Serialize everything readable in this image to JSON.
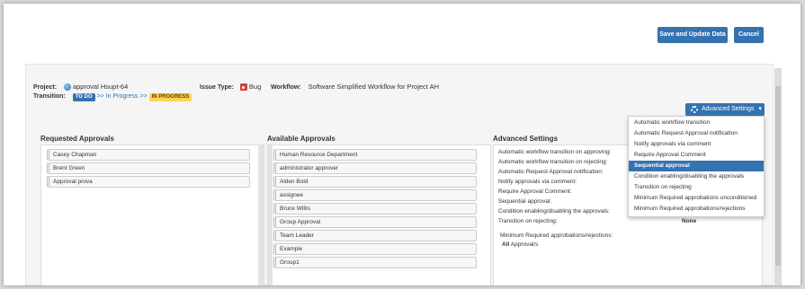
{
  "toolbar": {
    "save_label": "Save and Update Data",
    "cancel_label": "Cancel"
  },
  "issue": {
    "project_label": "Project:",
    "project_value": "approval Hsupt-64",
    "transition_label": "Transition:",
    "status_from": "TO DO",
    "sep1": ">>",
    "transition_name": "In Progress",
    "sep2": ">>",
    "status_to": "IN PROGRESS",
    "issue_type_label": "Issue Type:",
    "issue_type_value": "Bug",
    "workflow_label": "Workflow:",
    "workflow_value": "Software Simplified Workflow for Project AH"
  },
  "requested": {
    "title": "Requested Approvals",
    "items": [
      "Casey Chapman",
      "Brent Green",
      "Approval prova"
    ]
  },
  "available": {
    "title": "Available Approvals",
    "items": [
      "Human Resource Department",
      "administrator approver",
      "Alden Bold",
      "assignee",
      "Bruce Willis",
      "Group Approval",
      "Team Leader",
      "Example",
      "Group1"
    ]
  },
  "advanced": {
    "title": "Advanced Settings",
    "button_label": "Advanced Settings",
    "rows": [
      "Automatic workflow transition on approving:",
      "Automatic workflow transition on rejecting:",
      "Automatic Request Approval notification:",
      "Notify approvals via comment:",
      "Require Approval Comment:",
      "Sequential approval:",
      "Condition enabling/disabling the approvals:",
      "Transition on rejecting:"
    ],
    "transition_on_rejecting_value": "None",
    "min_label": "Minimum Required approbations/rejections:",
    "min_value_bold": "All",
    "min_value_rest": "Approval/s"
  },
  "menu": {
    "items": [
      "Automatic workflow transition",
      "Automatic Request Approval notification",
      "Notify approvals via comment",
      "Require Approval Comment",
      "Sequential approval",
      "Condition enabling/disabling the approvals",
      "Transition on rejecting",
      "Minimum Required approbations unconditioned",
      "Minimum Required approbations/rejections"
    ],
    "selected_index": 4
  },
  "colors": {
    "primary": "#3572b0",
    "in_progress": "#ffd351",
    "bug": "#d04437"
  },
  "icons": [
    "globe-icon",
    "bug-icon",
    "gear-icon",
    "caret-down-icon"
  ]
}
